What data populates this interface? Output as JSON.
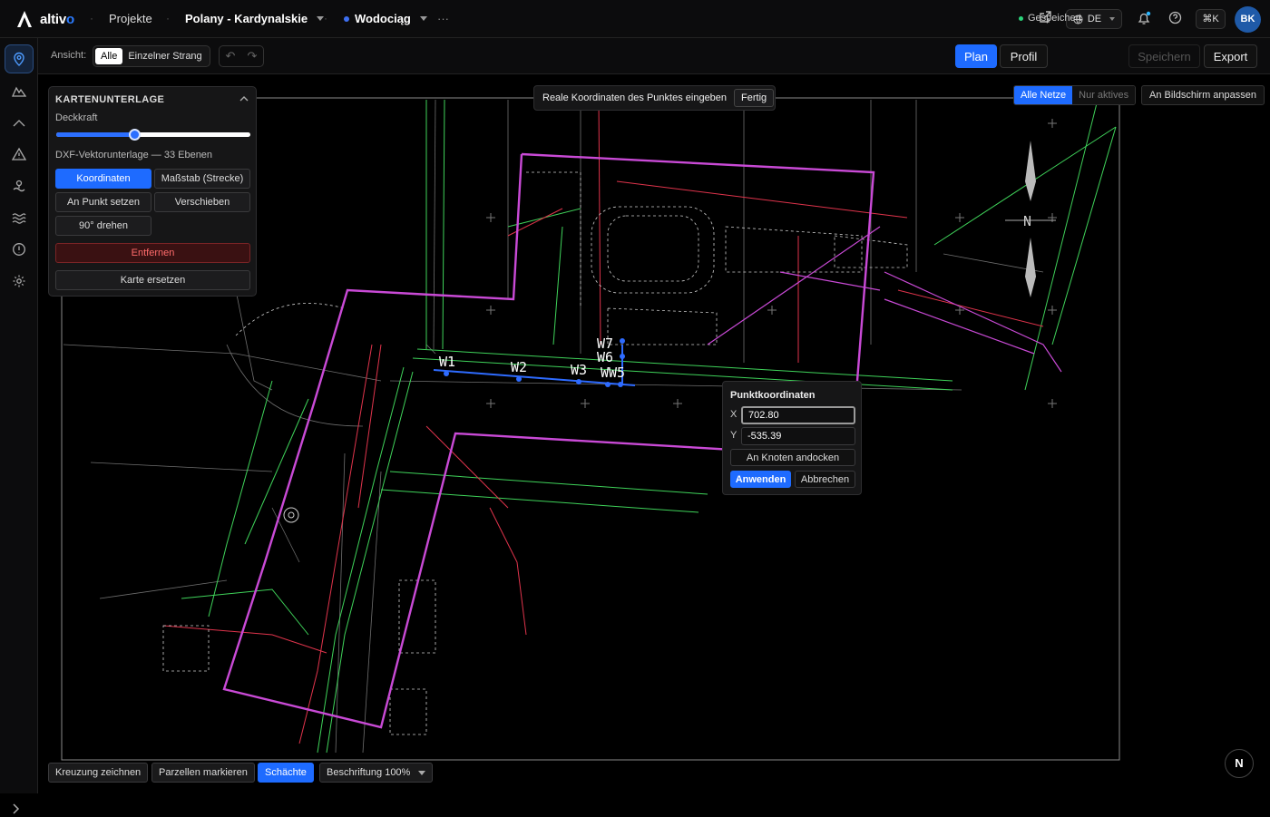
{
  "app": {
    "name_main": "altiv",
    "name_accent": "o"
  },
  "topbar": {
    "projects": "Projekte",
    "project": "Polany - Kardynalskie",
    "network": "Wodociąg",
    "more": "···",
    "lang": "DE",
    "shortcut": "⌘K",
    "avatar": "BK"
  },
  "toolbar": {
    "view_label": "Ansicht:",
    "view_all": "Alle",
    "view_single": "Einzelner Strang",
    "plan": "Plan",
    "profile": "Profil",
    "saved": "Gespeichert",
    "save": "Speichern",
    "export": "Export"
  },
  "panel": {
    "title": "KARTENUNTERLAGE",
    "opacity_label": "Deckkraft",
    "opacity_value": 0.4,
    "dxf_info": "DXF-Vektorunterlage — 33 Ebenen",
    "btn_coords": "Koordinaten",
    "btn_scale": "Maßstab (Strecke)",
    "btn_setpoint": "An Punkt setzen",
    "btn_move": "Verschieben",
    "btn_rotate": "90° drehen",
    "btn_remove": "Entfernen",
    "btn_replace": "Karte ersetzen"
  },
  "hint": {
    "text": "Reale Koordinaten des Punktes eingeben",
    "done": "Fertig"
  },
  "net": {
    "all": "Alle Netze",
    "active": "Nur aktives",
    "fit": "An Bildschirm anpassen"
  },
  "coords": {
    "title": "Punktkoordinaten",
    "x_label": "X",
    "x_value": "702.80",
    "y_label": "Y",
    "y_value": "-535.39",
    "snap": "An Knoten andocken",
    "apply": "Anwenden",
    "cancel": "Abbrechen"
  },
  "map": {
    "north": "N",
    "nodes": [
      "W1",
      "W2",
      "W3",
      "W7",
      "W6",
      "WW5"
    ],
    "colors": {
      "outline": "#c94ad6",
      "green": "#3fd35a",
      "red": "#e0344c",
      "pipe": "#2e6bff"
    }
  },
  "bottom": {
    "crossing": "Kreuzung zeichnen",
    "parcels": "Parzellen markieren",
    "shafts": "Schächte",
    "labels": "Beschriftung 100%",
    "nav": "N"
  }
}
